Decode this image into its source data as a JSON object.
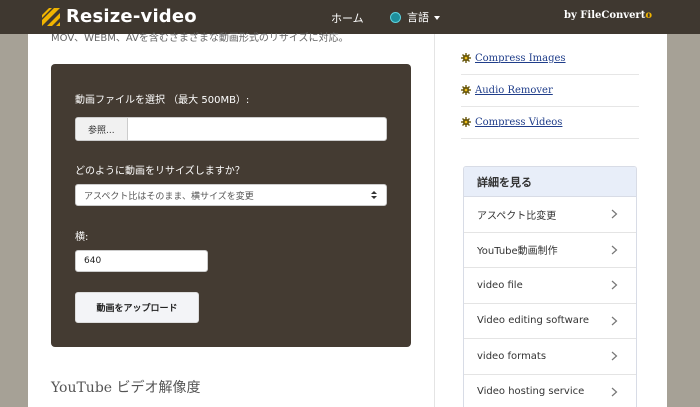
{
  "header": {
    "logo_text": "Resize-video",
    "nav_home": "ホーム",
    "nav_language": "言語",
    "byline_prefix": "by FileConvert",
    "byline_suffix": "o"
  },
  "main": {
    "intro_cut": "MOV、WEBM、AVを含むさまざまな動画形式のリサイズに対応。",
    "form": {
      "file_label": "動画ファイルを選択 （最大 500MB）:",
      "browse_label": "参照...",
      "resize_label": "どのように動画をリサイズしますか？",
      "resize_selected": "アスペクト比はそのまま、横サイズを変更",
      "width_label": "横:",
      "width_value": "640",
      "upload_label": "動画をアップロード"
    },
    "section_title": "YouTube ビデオ解像度"
  },
  "sidebar": {
    "links": [
      {
        "label": "Compress Images"
      },
      {
        "label": "Audio Remover"
      },
      {
        "label": "Compress Videos"
      }
    ],
    "details": {
      "title": "詳細を見る",
      "items": [
        {
          "label": "アスペクト比変更"
        },
        {
          "label": "YouTube動画制作"
        },
        {
          "label": "video file"
        },
        {
          "label": "Video editing software"
        },
        {
          "label": "video formats"
        },
        {
          "label": "Video hosting service"
        }
      ]
    }
  },
  "colors": {
    "header_bg": "#3f3830",
    "panel_bg": "#443b32",
    "logo_accent": "#f0b400",
    "link_color": "#1f3d8a",
    "details_head_bg": "#e8eef9"
  },
  "icons": {
    "logo": "diagonal-bars-logo-icon",
    "language": "globe-icon",
    "dropdown": "caret-down-icon",
    "link_bullet": "gear-icon",
    "details_item": "chevron-right-icon",
    "select": "select-arrows-icon"
  }
}
